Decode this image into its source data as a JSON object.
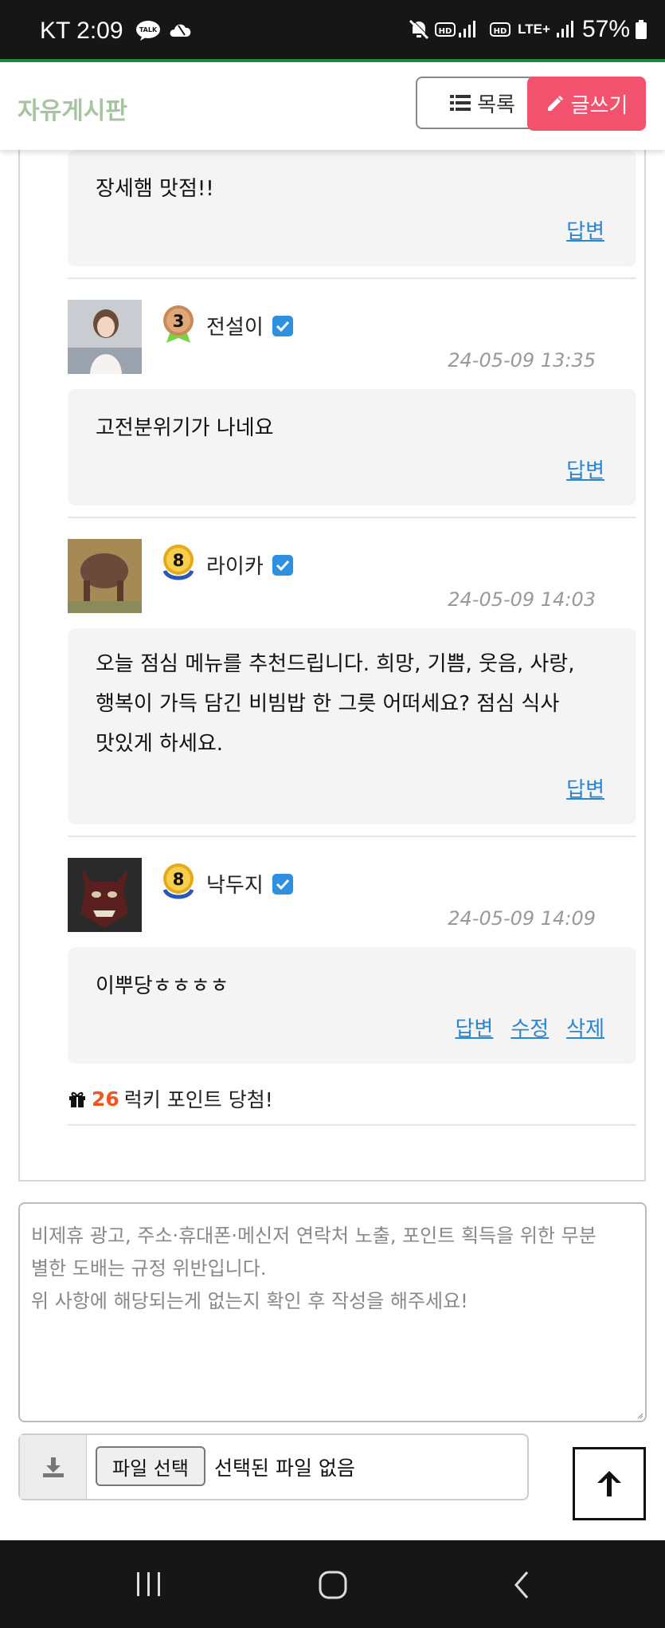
{
  "status_bar": {
    "carrier_time": "KT 2:09",
    "icons": [
      "talk-icon",
      "cloud-icon",
      "mute-icon",
      "hd-signal-icon",
      "lte-icon",
      "battery-icon"
    ],
    "lte_label": "LTE+",
    "battery": "57%"
  },
  "header": {
    "title": "자유게시판",
    "list_label": "목록",
    "write_label": "글쓰기"
  },
  "comments": [
    {
      "text": "장세햄 맛점!!",
      "reply": "답변"
    },
    {
      "level": "3",
      "nick": "전설이",
      "date": "24-05-09 13:35",
      "text": "고전분위기가 나네요",
      "reply": "답변"
    },
    {
      "level": "8",
      "nick": "라이카",
      "date": "24-05-09 14:03",
      "lines": [
        "오늘 점심 메뉴를 추천드립니다. 희망, 기쁨, 웃음, 사랑,",
        "행복이 가득 담긴 비빔밥 한 그릇 어떠세요? 점심 식사",
        "맛있게 하세요."
      ],
      "reply": "답변"
    },
    {
      "level": "8",
      "nick": "낙두지",
      "date": "24-05-09 14:09",
      "text": "이뿌당ㅎㅎㅎㅎ",
      "reply": "답변",
      "edit": "수정",
      "delete": "삭제"
    }
  ],
  "lucky": {
    "points": "26",
    "text": "럭키 포인트 당첨!"
  },
  "comment_form": {
    "placeholder_lines": [
      "비제휴 광고, 주소·휴대폰·메신저 연락처 노출, 포인트 획득을 위한 무분",
      "별한 도배는 규정 위반입니다.",
      "위 사항에 해당되는게 없는지 확인 후 작성을 해주세요!"
    ],
    "file_button": "파일 선택",
    "file_status": "선택된 파일 없음"
  },
  "colors": {
    "accent_green": "#1c8a3a",
    "write_button": "#f2526e",
    "link": "#2b86d2",
    "lucky_number": "#f0561d",
    "title": "#a7c4a0"
  }
}
